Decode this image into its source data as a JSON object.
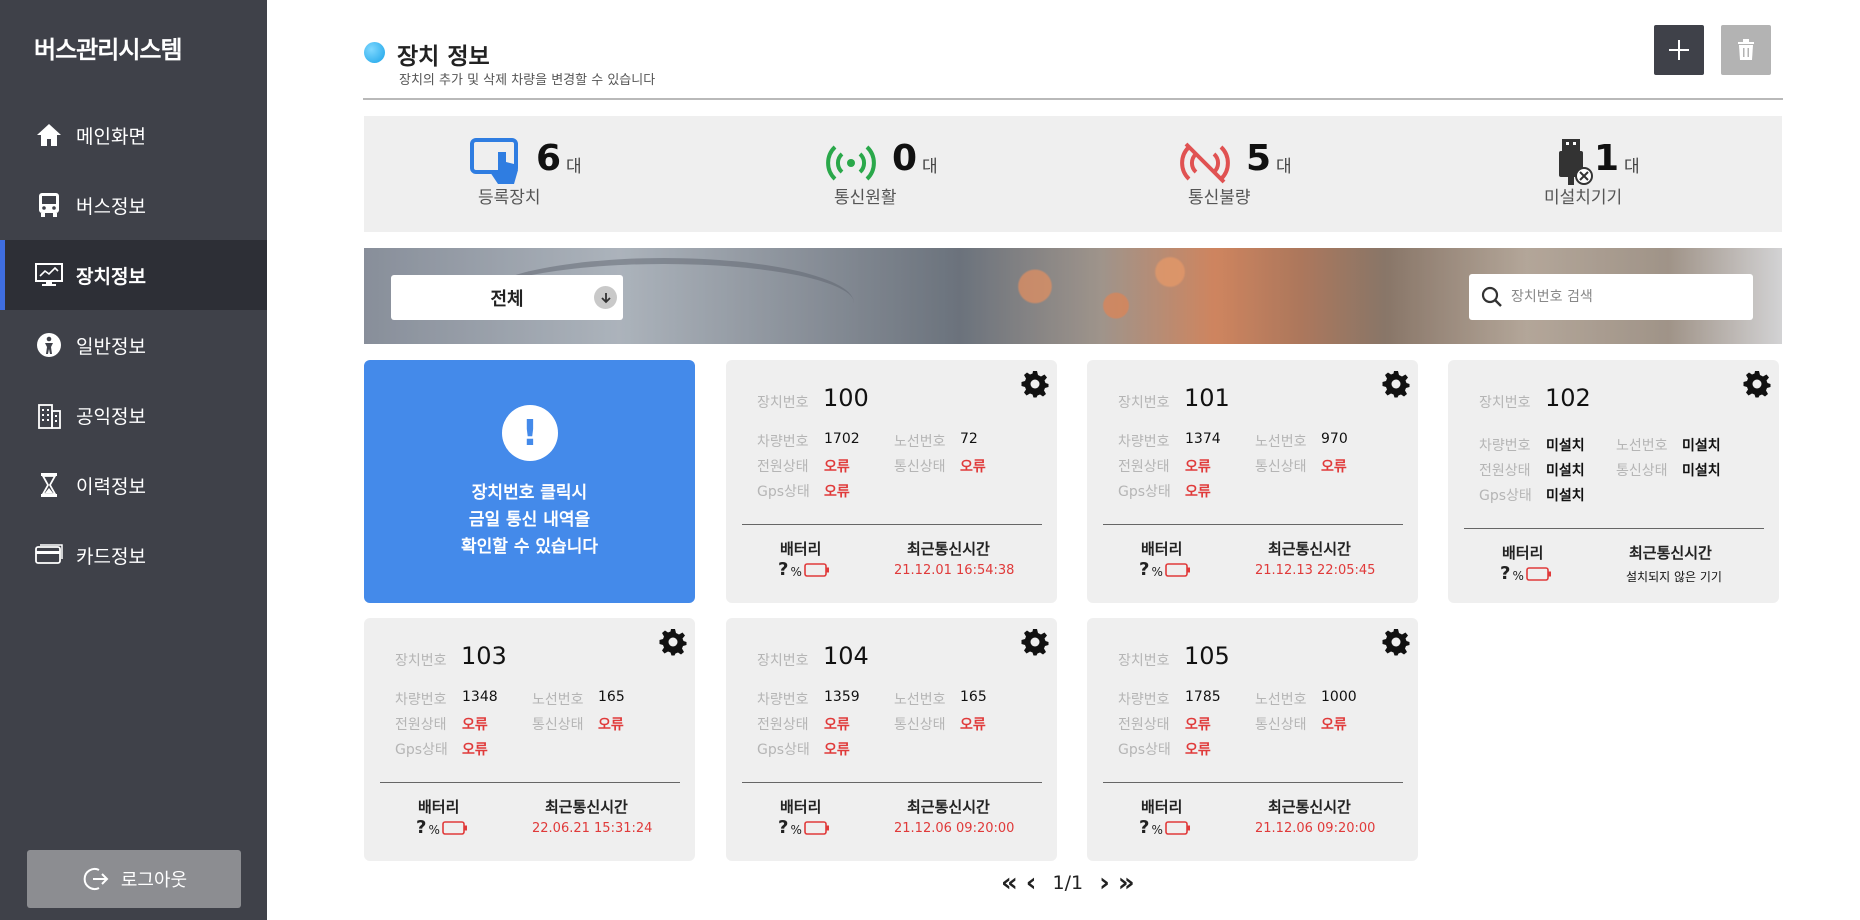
{
  "app": {
    "title": "버스관리시스템"
  },
  "sidebar": {
    "items": [
      {
        "label": "메인화면",
        "icon": "home-icon"
      },
      {
        "label": "버스정보",
        "icon": "bus-icon"
      },
      {
        "label": "장치정보",
        "icon": "monitor-icon",
        "active": true
      },
      {
        "label": "일반정보",
        "icon": "person-icon"
      },
      {
        "label": "공익정보",
        "icon": "building-icon"
      },
      {
        "label": "이력정보",
        "icon": "hourglass-icon"
      },
      {
        "label": "카드정보",
        "icon": "card-icon"
      }
    ],
    "logout_label": "로그아웃"
  },
  "header": {
    "title": "장치 정보",
    "subtitle": "장치의 추가 및 삭제 차량을 변경할 수 있습니다"
  },
  "stats": {
    "registered": {
      "value": "6",
      "unit": "대",
      "label": "등록장치",
      "color": "#2f7de1"
    },
    "comm_ok": {
      "value": "0",
      "unit": "대",
      "label": "통신원활",
      "color": "#2aa84a"
    },
    "comm_bad": {
      "value": "5",
      "unit": "대",
      "label": "통신불량",
      "color": "#e05252"
    },
    "uninstalled": {
      "value": "1",
      "unit": "대",
      "label": "미설치기기",
      "color": "#333333"
    }
  },
  "filter": {
    "selected": "전체",
    "search_placeholder": "장치번호 검색"
  },
  "info_card": {
    "line1": "장치번호 클릭시",
    "line2": "금일 통신 내역을",
    "line3": "확인할 수 있습니다"
  },
  "labels": {
    "device_no": "장치번호",
    "vehicle_no": "차량번호",
    "route_no": "노선번호",
    "power": "전원상태",
    "comm": "통신상태",
    "gps": "Gps상태",
    "battery": "배터리",
    "last_comm": "최근통신시간",
    "battery_q": "?",
    "battery_pct": "%"
  },
  "devices": [
    {
      "no": "100",
      "vehicle": "1702",
      "route": "72",
      "power": "오류",
      "comm": "오류",
      "gps": "오류",
      "last": "21.12.01 16:54:38"
    },
    {
      "no": "101",
      "vehicle": "1374",
      "route": "970",
      "power": "오류",
      "comm": "오류",
      "gps": "오류",
      "last": "21.12.13 22:05:45"
    },
    {
      "no": "102",
      "vehicle": "미설치",
      "route": "미설치",
      "power": "미설치",
      "comm": "미설치",
      "gps": "미설치",
      "last": "설치되지 않은 기기"
    },
    {
      "no": "103",
      "vehicle": "1348",
      "route": "165",
      "power": "오류",
      "comm": "오류",
      "gps": "오류",
      "last": "22.06.21 15:31:24"
    },
    {
      "no": "104",
      "vehicle": "1359",
      "route": "165",
      "power": "오류",
      "comm": "오류",
      "gps": "오류",
      "last": "21.12.06 09:20:00"
    },
    {
      "no": "105",
      "vehicle": "1785",
      "route": "1000",
      "power": "오류",
      "comm": "오류",
      "gps": "오류",
      "last": "21.12.06 09:20:00"
    }
  ],
  "pagination": {
    "text": "1/1",
    "first": "«",
    "prev": "‹",
    "next": "›",
    "last": "»"
  },
  "colors": {
    "sidebar": "#3f4149",
    "accent": "#448aea",
    "error": "#e03a3a"
  }
}
